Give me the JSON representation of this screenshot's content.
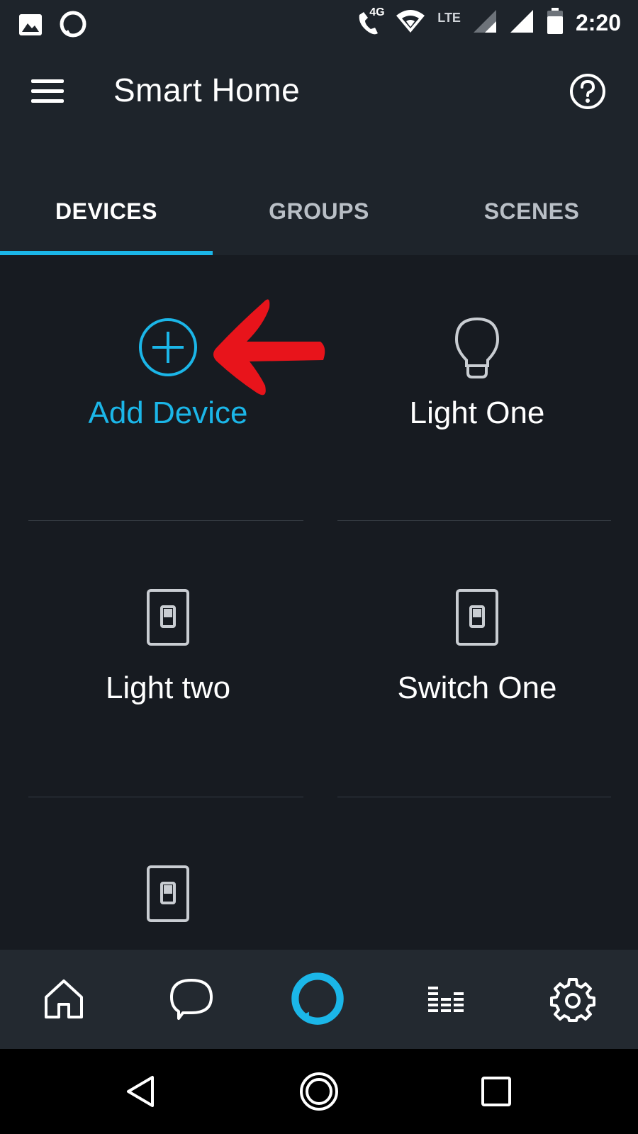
{
  "status_bar": {
    "time": "2:20",
    "network_label": "LTE",
    "call_badge": "4G",
    "icons": [
      "image-icon",
      "alexa-ring-icon",
      "wifi-call-icon",
      "wifi-icon",
      "signal-icon",
      "signal-icon",
      "battery-icon"
    ]
  },
  "app_bar": {
    "title": "Smart Home",
    "menu_icon": "hamburger-menu-icon",
    "help_icon": "help-circle-icon"
  },
  "tabs": [
    {
      "label": "DEVICES",
      "active": true
    },
    {
      "label": "GROUPS",
      "active": false
    },
    {
      "label": "SCENES",
      "active": false
    }
  ],
  "devices": [
    {
      "label": "Add Device",
      "icon": "add-circle-icon"
    },
    {
      "label": "Light One",
      "icon": "light-bulb-icon"
    },
    {
      "label": "Light two",
      "icon": "light-switch-icon"
    },
    {
      "label": "Switch One",
      "icon": "light-switch-icon"
    },
    {
      "label": "",
      "icon": "light-switch-icon"
    }
  ],
  "bottom_nav": [
    "home-icon",
    "chat-icon",
    "alexa-icon",
    "music-icon",
    "settings-icon"
  ],
  "system_nav": [
    "back-icon",
    "home-circle-icon",
    "recents-icon"
  ],
  "colors": {
    "accent": "#1bb6e8",
    "background": "#171b21",
    "bar": "#1e242b",
    "annotation": "#e8141b"
  }
}
